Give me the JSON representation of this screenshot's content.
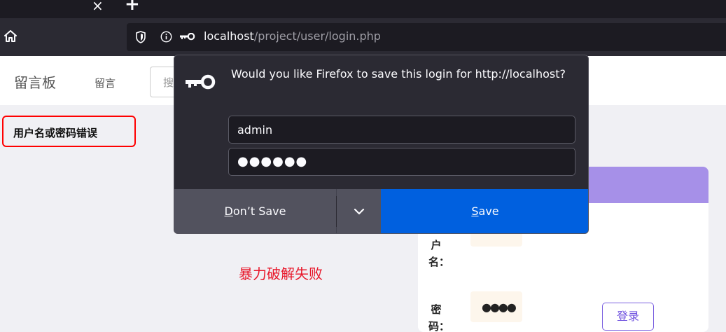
{
  "browser": {
    "tab_close_glyph": "×",
    "new_tab_glyph": "+",
    "url_host": "localhost",
    "url_path": "/project/user/login.php"
  },
  "site": {
    "brand": "留言板",
    "nav_link": "留言",
    "search_placeholder": "搜",
    "error_message": "用户名或密码错误",
    "annotation": "暴力破解失败"
  },
  "login_card": {
    "username_label": "户名：",
    "password_label": "密码：",
    "password_dots": "●●●●",
    "login_button": "登录",
    "header_color": "#a690e8"
  },
  "password_prompt": {
    "message": "Would you like Firefox to save this login for http://localhost?",
    "username_value": "admin",
    "password_value": "●●●●●●",
    "dont_save_mnemonic": "D",
    "dont_save_rest": "on’t Save",
    "save_mnemonic": "S",
    "save_rest": "ave",
    "save_color": "#0060df"
  }
}
